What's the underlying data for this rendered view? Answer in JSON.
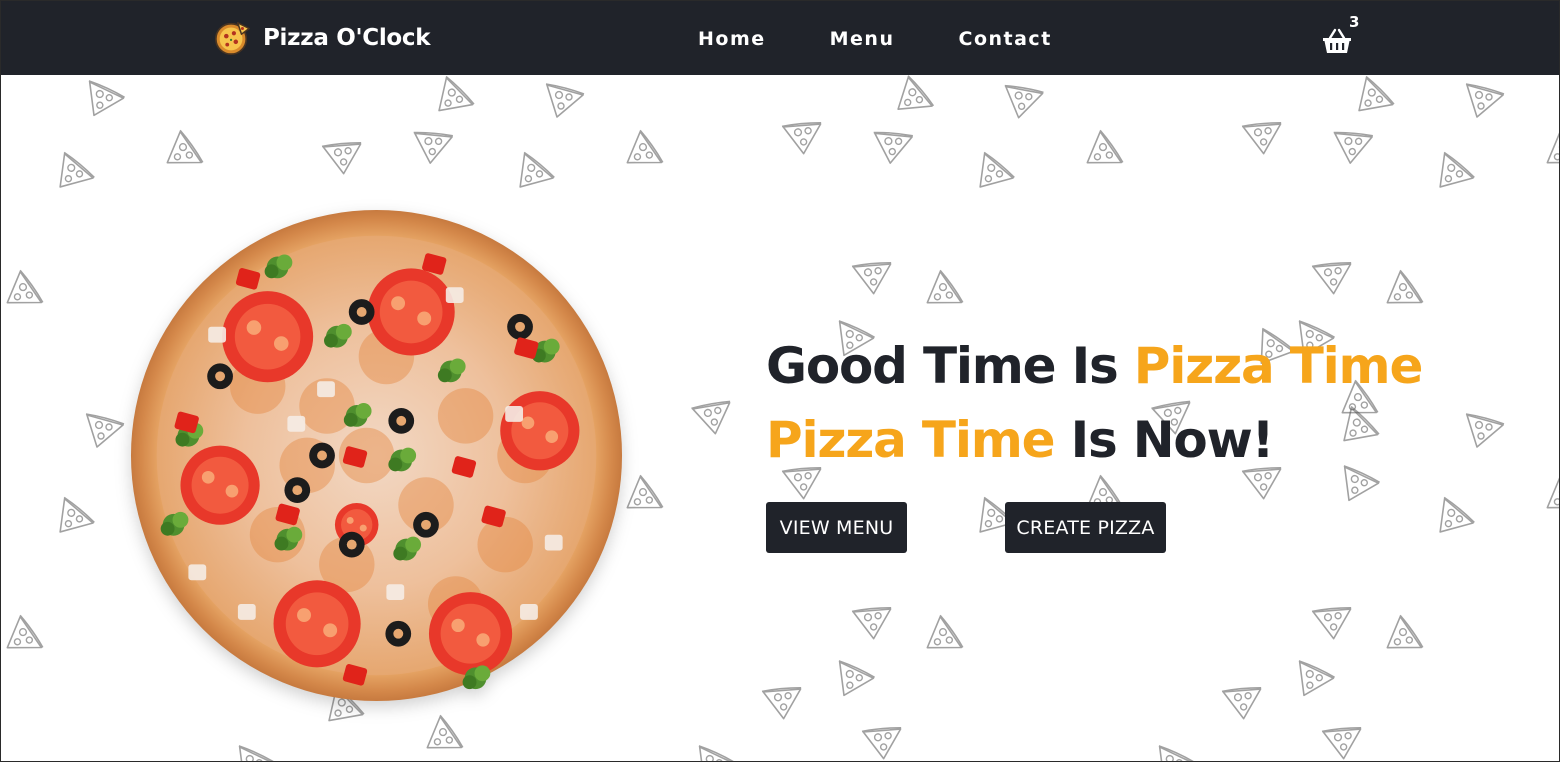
{
  "navbar": {
    "brand": {
      "name": "Pizza O'Clock",
      "logo_icon": "pizza-logo-icon"
    },
    "links": [
      {
        "label": "Home"
      },
      {
        "label": "Menu"
      },
      {
        "label": "Contact"
      }
    ],
    "cart": {
      "icon": "shopping-basket-icon",
      "count": "3"
    }
  },
  "hero": {
    "image": "pizza-image",
    "headline": {
      "line1_dark": "Good Time Is ",
      "line1_accent": "Pizza Time",
      "line2_accent": "Pizza Time",
      "line2_dark": " Is Now!"
    },
    "buttons": {
      "view_menu": "VIEW MENU",
      "create_pizza": "CREATE PIZZA"
    }
  },
  "colors": {
    "navbar_bg": "#20232a",
    "accent": "#f6a51b",
    "text_dark": "#20232a",
    "background": "#ffffff"
  },
  "background_pattern_icon": "pizza-slice-outline-icon"
}
